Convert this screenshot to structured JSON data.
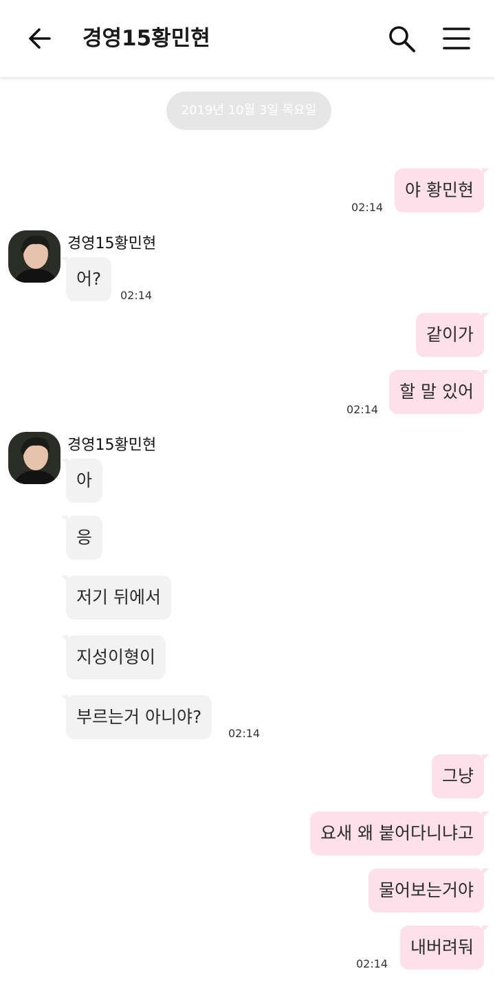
{
  "header": {
    "back_icon": "arrow-left-icon",
    "title": "경영15황민현",
    "search_icon": "search-icon",
    "menu_icon": "hamburger-menu-icon"
  },
  "date_divider": "2019년 10월 3일 목요일",
  "contact": {
    "name": "경영15황민현",
    "avatar_icon": "profile-photo"
  },
  "messages": [
    {
      "from": "me",
      "text": "야 황민현",
      "time": "02:14"
    },
    {
      "from": "them",
      "text": "어?",
      "time": "02:14"
    },
    {
      "from": "me",
      "text": "같이가"
    },
    {
      "from": "me",
      "text": "할 말 있어",
      "time": "02:14"
    },
    {
      "from": "them",
      "text": "아"
    },
    {
      "from": "them",
      "text": "응"
    },
    {
      "from": "them",
      "text": "저기 뒤에서"
    },
    {
      "from": "them",
      "text": "지성이형이"
    },
    {
      "from": "them",
      "text": "부르는거 아니야?",
      "time": "02:14"
    },
    {
      "from": "me",
      "text": "그냥"
    },
    {
      "from": "me",
      "text": "요새 왜 붙어다니냐고"
    },
    {
      "from": "me",
      "text": "물어보는거야"
    },
    {
      "from": "me",
      "text": "내버려둬",
      "time": "02:14"
    }
  ],
  "colors": {
    "my_bubble": "#fde0ea",
    "their_bubble": "#f2f2f2",
    "date_pill": "#e6e6e6"
  }
}
